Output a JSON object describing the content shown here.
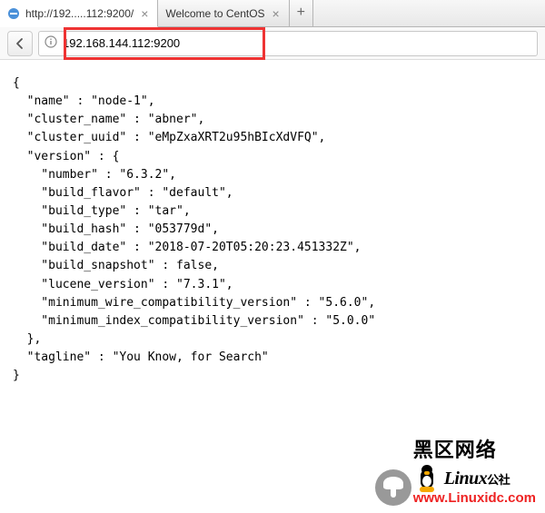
{
  "tabs": [
    {
      "title": "http://192.....112:9200/",
      "active": true
    },
    {
      "title": "Welcome to CentOS",
      "active": false
    }
  ],
  "url": "192.168.144.112:9200",
  "json_body": "{\n  \"name\" : \"node-1\",\n  \"cluster_name\" : \"abner\",\n  \"cluster_uuid\" : \"eMpZxaXRT2u95hBIcXdVFQ\",\n  \"version\" : {\n    \"number\" : \"6.3.2\",\n    \"build_flavor\" : \"default\",\n    \"build_type\" : \"tar\",\n    \"build_hash\" : \"053779d\",\n    \"build_date\" : \"2018-07-20T05:20:23.451332Z\",\n    \"build_snapshot\" : false,\n    \"lucene_version\" : \"7.3.1\",\n    \"minimum_wire_compatibility_version\" : \"5.6.0\",\n    \"minimum_index_compatibility_version\" : \"5.0.0\"\n  },\n  \"tagline\" : \"You Know, for Search\"\n}",
  "watermark": {
    "cn_text": "黑区网络",
    "linux_text": "Linux",
    "community_suffix": "公社",
    "url_text": "www.Linuxidc.com"
  }
}
